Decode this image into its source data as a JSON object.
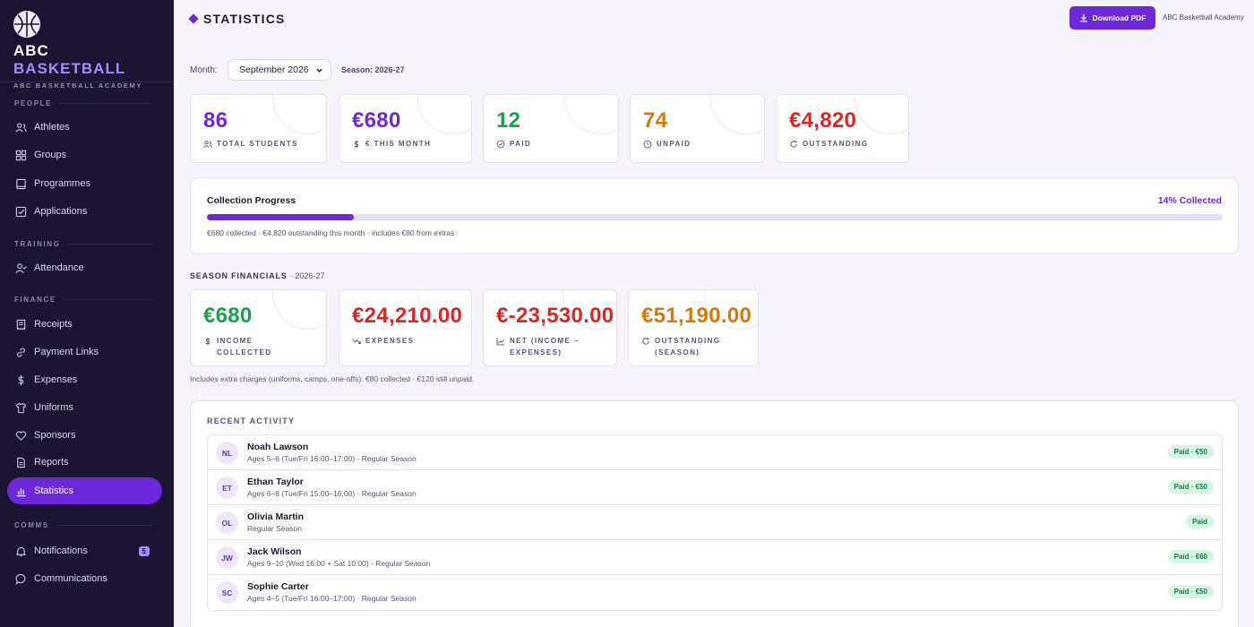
{
  "brand": {
    "title_main": "ABC",
    "title_accent": "BASKETBALL",
    "subtitle": "ABC BASKETBALL ACADEMY"
  },
  "sidebar": {
    "sections": [
      {
        "label": "PEOPLE"
      },
      {
        "label": "TRAINING"
      },
      {
        "label": "FINANCE"
      },
      {
        "label": "COMMS"
      }
    ],
    "items": [
      {
        "label": "Athletes",
        "icon": "users-icon"
      },
      {
        "label": "Groups",
        "icon": "grid-icon"
      },
      {
        "label": "Programmes",
        "icon": "book-icon"
      },
      {
        "label": "Applications",
        "icon": "check-square-icon"
      },
      {
        "label": "Attendance",
        "icon": "user-check-icon"
      },
      {
        "label": "Receipts",
        "icon": "receipt-icon"
      },
      {
        "label": "Payment Links",
        "icon": "link-icon"
      },
      {
        "label": "Expenses",
        "icon": "dollar-icon"
      },
      {
        "label": "Uniforms",
        "icon": "shirt-icon"
      },
      {
        "label": "Sponsors",
        "icon": "heart-icon"
      },
      {
        "label": "Reports",
        "icon": "document-icon"
      },
      {
        "label": "Statistics",
        "icon": "bar-chart-icon",
        "active": true
      },
      {
        "label": "Notifications",
        "icon": "bell-icon",
        "badge": "5"
      },
      {
        "label": "Communications",
        "icon": "chat-icon"
      }
    ]
  },
  "header": {
    "title": "STATISTICS",
    "download_label": "Download PDF",
    "org_name": "ABC Basketball Academy"
  },
  "filters": {
    "month_label": "Month:",
    "month_value": "September 2026",
    "season_label": "Season: 2026-27"
  },
  "stats": [
    {
      "value": "86",
      "label": "TOTAL STUDENTS",
      "color": "#6d28d9",
      "icon": "users-icon"
    },
    {
      "value": "€680",
      "label": "€ THIS MONTH",
      "color": "#6d28d9",
      "icon": "dollar-icon"
    },
    {
      "value": "12",
      "label": "PAID",
      "color": "#16a34a",
      "icon": "check-circle-icon"
    },
    {
      "value": "74",
      "label": "UNPAID",
      "color": "#d97706",
      "icon": "clock-icon"
    },
    {
      "value": "€4,820",
      "label": "OUTSTANDING",
      "color": "#dc2626",
      "icon": "refresh-icon"
    }
  ],
  "progress": {
    "title": "Collection Progress",
    "percent_label": "14% Collected",
    "percent": 14.5,
    "note": "€680 collected · €4,820 outstanding this month · includes €80 from extras"
  },
  "season_financials": {
    "heading": "SEASON FINANCIALS",
    "heading_suffix": "· 2026-27",
    "cards": [
      {
        "value": "€680",
        "label_line1": "INCOME",
        "label_line2": "COLLECTED",
        "color": "#16a34a",
        "icon": "dollar-icon"
      },
      {
        "value": "€24,210.00",
        "label_line1": "EXPENSES",
        "label_line2": "",
        "color": "#dc2626",
        "icon": "trend-down-icon"
      },
      {
        "value": "€-23,530.00",
        "label_line1": "NET (INCOME −",
        "label_line2": "EXPENSES)",
        "color": "#dc2626",
        "icon": "chart-line-icon"
      },
      {
        "value": "€51,190.00",
        "label_line1": "OUTSTANDING",
        "label_line2": "(SEASON)",
        "color": "#d97706",
        "icon": "refresh-icon"
      }
    ],
    "note": "Includes extra charges (uniforms, camps, one-offs): €80 collected · €120 still unpaid."
  },
  "activity": {
    "heading": "RECENT ACTIVITY",
    "rows": [
      {
        "initials": "NL",
        "name": "Noah Lawson",
        "meta": "Ages 5–6 (Tue/Fri 16:00–17:00) · Regular Season",
        "status": "Paid · €50"
      },
      {
        "initials": "ET",
        "name": "Ethan Taylor",
        "meta": "Ages 6–8 (Tue/Fri 15:00–16:00) · Regular Season",
        "status": "Paid · €50"
      },
      {
        "initials": "OL",
        "name": "Olivia Martin",
        "meta": "Regular Season",
        "status": "Paid"
      },
      {
        "initials": "JW",
        "name": "Jack Wilson",
        "meta": "Ages 9–10 (Wed 16:00 + Sat 10:00) · Regular Season",
        "status": "Paid · €60"
      },
      {
        "initials": "SC",
        "name": "Sophie Carter",
        "meta": "Ages 4–5 (Tue/Fri 16:00–17:00) · Regular Season",
        "status": "Paid · €50"
      }
    ]
  }
}
